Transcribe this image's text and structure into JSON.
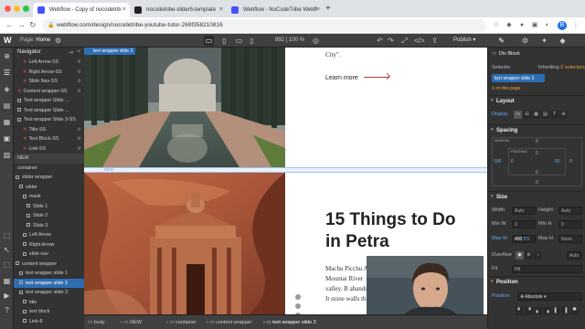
{
  "browser": {
    "tabs": [
      {
        "title": "Webflow - Copy of nocodetrib",
        "active": true,
        "favicon_color": "#4353ff"
      },
      {
        "title": "nocodetribe-slider5-template",
        "active": false,
        "favicon_color": "#222222"
      },
      {
        "title": "Webflow - NoCodeTribe Webfl",
        "active": false,
        "favicon_color": "#4353ff"
      }
    ],
    "new_tab": "+",
    "url": "webflow.com/design/nocodetribe-youtube-tutor-269f358210816",
    "profile_initial": "B"
  },
  "designer": {
    "logo": "W",
    "page_label": "Page:",
    "page_name": "Home",
    "canvas_dims": "992  |  100 %",
    "publish_label": "Publish"
  },
  "navigator": {
    "title": "Navigator",
    "rows": [
      {
        "label": "Left Arrow-SS",
        "type": "sym"
      },
      {
        "label": "Right Arrow-SS",
        "type": "sym"
      },
      {
        "label": "Slide Nav-SS",
        "type": "sym"
      },
      {
        "label": "Content wrapper-SS",
        "type": "sym"
      },
      {
        "label": "Text wrapper Slide ...",
        "type": "box"
      },
      {
        "label": "Text wrapper Slide ...",
        "type": "box"
      },
      {
        "label": "Text wrapper Slide 3-SS",
        "type": "box"
      },
      {
        "label": "Title-SS",
        "type": "sym"
      },
      {
        "label": "Text Block-SS",
        "type": "sym"
      },
      {
        "label": "Link-SS",
        "type": "sym"
      },
      {
        "label": "NEW",
        "type": "plain"
      },
      {
        "label": "container",
        "type": "plain"
      },
      {
        "label": "slider wrapper",
        "type": "box"
      },
      {
        "label": "slider",
        "type": "box"
      },
      {
        "label": "mask",
        "type": "box"
      },
      {
        "label": "Slide 1",
        "type": "box"
      },
      {
        "label": "Slide 2",
        "type": "box"
      },
      {
        "label": "Slide 3",
        "type": "box"
      },
      {
        "label": "Left Arrow",
        "type": "box"
      },
      {
        "label": "Right Arrow",
        "type": "box"
      },
      {
        "label": "slide nav",
        "type": "box"
      },
      {
        "label": "content wrapper",
        "type": "box"
      },
      {
        "label": "text wrapper slide 1",
        "type": "box"
      },
      {
        "label": "text wrapper slide 2",
        "type": "box",
        "selected": true
      },
      {
        "label": "text wrapper slide 3",
        "type": "box"
      },
      {
        "label": "title",
        "type": "box"
      },
      {
        "label": "text block",
        "type": "box"
      },
      {
        "label": "Link-8",
        "type": "box"
      }
    ]
  },
  "canvas": {
    "selection_tag": "text wrapper slide 2",
    "city_text": "City\".",
    "learn_more": "Learn more",
    "section_tag": "NEW",
    "headline_line1": "15 Things to Do",
    "headline_line2": "in Petra",
    "paragraph": "Machu Picchu Andes Mountai River valley. B abandoned. It stone walls th"
  },
  "breadcrumbs": [
    "body",
    "NEW",
    "container",
    "content wrapper",
    "text wrapper slide 2"
  ],
  "style_panel": {
    "element_type": "Div Block",
    "selector_label": "Selector",
    "inheriting": "Inheriting",
    "inheriting_count": "2 selectors",
    "selector_chip": "text wrapper slide 2",
    "on_this_page": "1 on this page",
    "sections": {
      "layout": "Layout",
      "spacing": "Spacing",
      "size": "Size",
      "position": "Position"
    },
    "display_label": "Display",
    "spacing": {
      "margin_label": "MARGIN",
      "padding_label": "PADDING",
      "left": "100",
      "right": "50",
      "values": [
        "0",
        "0",
        "0",
        "0",
        "0",
        "0"
      ]
    },
    "size": {
      "width_label": "Width",
      "width_value": "Auto",
      "height_label": "Height",
      "height_value": "Auto",
      "minw_label": "Min W",
      "minw_value": "0",
      "minh_label": "Min H",
      "minh_value": "0",
      "maxw_label": "Max W",
      "maxw_value": "400",
      "maxw_unit": "PX",
      "maxh_label": "Max H",
      "maxh_value": "None",
      "overflow_label": "Overflow",
      "overflow_value": "Auto",
      "fit_label": "Fit",
      "fit_value": "Fill"
    },
    "position": {
      "label": "Position",
      "value": "Absolute"
    }
  },
  "colors": {
    "accent": "#2f6db3",
    "arrow": "#c0392b",
    "panel_bg": "#333333"
  }
}
